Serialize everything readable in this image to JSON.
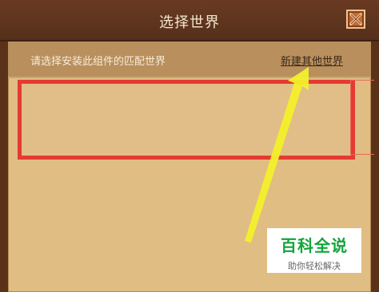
{
  "dialog": {
    "title": "选择世界",
    "close_icon": "close-icon"
  },
  "header": {
    "prompt": "请选择安装此组件的匹配世界",
    "new_world_link": "新建其他世界"
  },
  "watermark": {
    "main": "百科全说",
    "sub": "助你轻松解决"
  },
  "colors": {
    "title_bar": "#6a3a22",
    "panel": "#e0bd83",
    "header_bar": "#b88f5d",
    "highlight_box": "#e43a32",
    "arrow": "#f2f02a",
    "watermark_green": "#12a53a"
  }
}
